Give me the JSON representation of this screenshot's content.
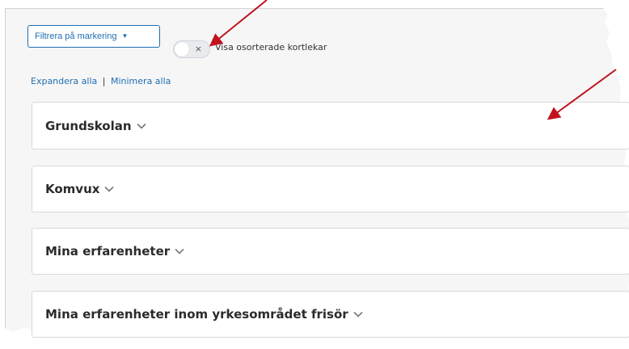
{
  "toolbar": {
    "filter_button_label": "Filtrera på markering",
    "show_unsorted_label": "Visa osorterade kortlekar",
    "toggle_state_symbol": "×"
  },
  "links": {
    "expand_all": "Expandera alla",
    "separator": "|",
    "collapse_all": "Minimera alla"
  },
  "sections": [
    {
      "label": "Grundskolan"
    },
    {
      "label": "Komvux"
    },
    {
      "label": "Mina erfarenheter"
    },
    {
      "label": "Mina erfarenheter inom yrkesområdet frisör"
    }
  ],
  "colors": {
    "accent": "#1f6fb2",
    "annotation_arrow": "#c1121f"
  }
}
